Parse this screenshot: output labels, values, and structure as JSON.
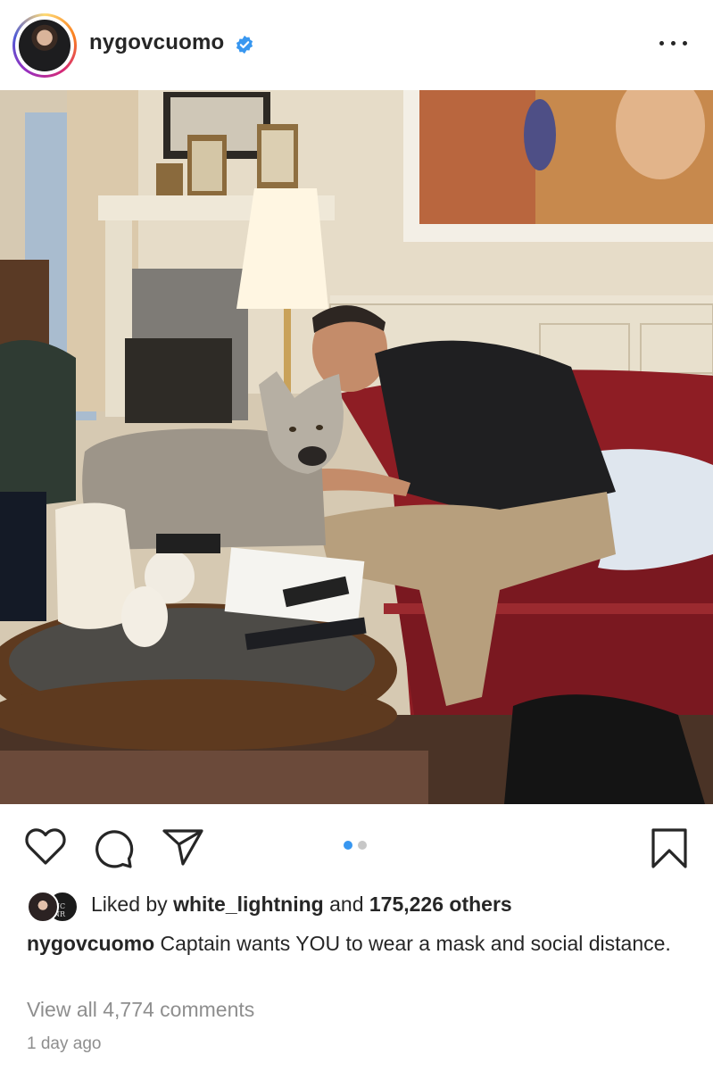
{
  "post": {
    "username": "nygovcuomo",
    "verified": true,
    "more_icon": "more-horizontal-icon"
  },
  "photo": {
    "subject": "photo"
  },
  "actions": {
    "like_icon": "heart-icon",
    "comment_icon": "comment-icon",
    "share_icon": "paper-plane-icon",
    "save_icon": "bookmark-icon",
    "carousel_count": 2,
    "carousel_active": 1
  },
  "likes": {
    "prefix": "Liked by ",
    "user": "white_lightning",
    "middle": " and ",
    "count": "175,226 others",
    "liker2_badge": "NC NR"
  },
  "caption": {
    "username": "nygovcuomo",
    "text": " Captain wants YOU to wear a mask and social distance."
  },
  "comments": {
    "link": "View all 4,774 comments"
  },
  "timestamp": "1 day ago",
  "colors": {
    "text": "#262626",
    "muted": "#8e8e8e",
    "verified": "#3897f0",
    "carousel_active": "#3897f0",
    "carousel_inactive": "#c7c7c7"
  }
}
